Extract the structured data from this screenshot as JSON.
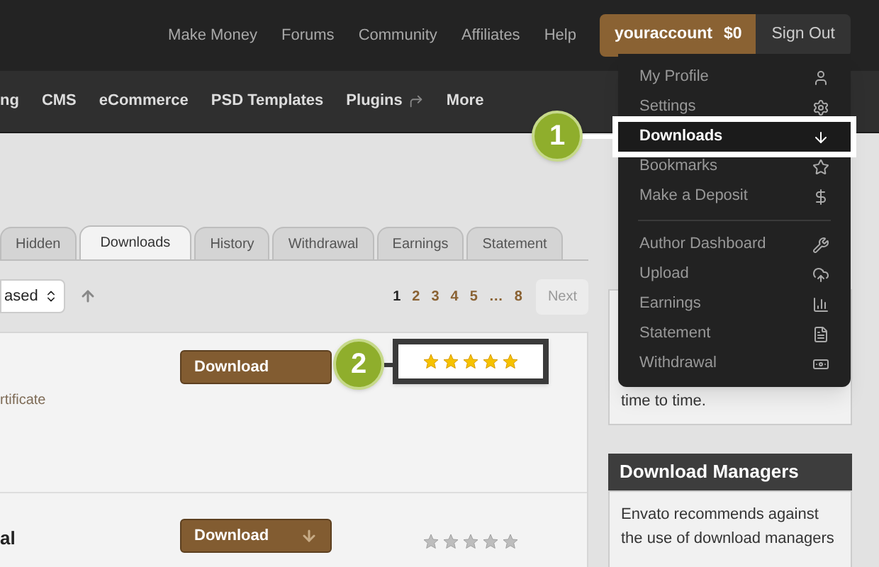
{
  "top_nav": [
    "Make Money",
    "Forums",
    "Community",
    "Affiliates",
    "Help"
  ],
  "account": {
    "name": "youraccount",
    "balance": "$0",
    "sign_out": "Sign Out"
  },
  "category_nav": [
    {
      "label": "ng",
      "kind": "plain"
    },
    {
      "label": "CMS",
      "kind": "plain"
    },
    {
      "label": "eCommerce",
      "kind": "plain"
    },
    {
      "label": "PSD Templates",
      "kind": "plain"
    },
    {
      "label": "Plugins",
      "kind": "external"
    },
    {
      "label": "More",
      "kind": "plain"
    }
  ],
  "tabs": [
    {
      "label": "Hidden",
      "selected": false
    },
    {
      "label": "Downloads",
      "selected": true
    },
    {
      "label": "History",
      "selected": false
    },
    {
      "label": "Withdrawal",
      "selected": false
    },
    {
      "label": "Earnings",
      "selected": false
    },
    {
      "label": "Statement",
      "selected": false
    }
  ],
  "sort_select": {
    "value": "ased"
  },
  "pagination": {
    "pages": [
      {
        "label": "1",
        "selected": true
      },
      {
        "label": "2",
        "selected": false
      },
      {
        "label": "3",
        "selected": false
      },
      {
        "label": "4",
        "selected": false
      },
      {
        "label": "5",
        "selected": false
      },
      {
        "label": "…",
        "selected": false
      },
      {
        "label": "8",
        "selected": false
      }
    ],
    "next": "Next"
  },
  "rows": [
    {
      "note": "rtificate",
      "button": "Download",
      "stars": 5,
      "callout": "2"
    },
    {
      "title": "al",
      "button": "Download",
      "stars": 0
    }
  ],
  "sidebar": {
    "box_text": "time to time.",
    "managers_title": "Download Managers",
    "managers_text": "Envato recommends against the use of download managers"
  },
  "account_menu": [
    {
      "items": [
        {
          "label": "My Profile",
          "selected": false
        },
        {
          "label": "Settings",
          "selected": false
        },
        {
          "label": "Downloads",
          "selected": true,
          "callout": "1"
        },
        {
          "label": "Bookmarks",
          "selected": false
        },
        {
          "label": "Make a Deposit",
          "selected": false
        }
      ]
    },
    {
      "items": [
        {
          "label": "Author Dashboard",
          "selected": false
        },
        {
          "label": "Upload",
          "selected": false
        },
        {
          "label": "Earnings",
          "selected": false
        },
        {
          "label": "Statement",
          "selected": false
        },
        {
          "label": "Withdrawal",
          "selected": false
        }
      ]
    }
  ]
}
